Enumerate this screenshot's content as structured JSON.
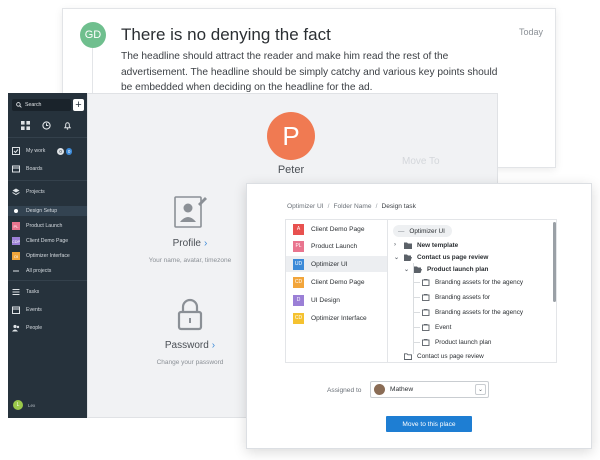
{
  "message": {
    "avatar_initials": "GD",
    "title": "There is no denying the fact",
    "date": "Today",
    "body": "The headline should attract the reader and make him read the rest of the advertisement. The headline should be simply catchy and various key points should be embedded when deciding on the headline for the ad."
  },
  "profile": {
    "avatar_initial": "P",
    "name": "Peter",
    "ghost_text": "Move To",
    "tiles": [
      {
        "title": "Profile",
        "subtitle": "Your name, avatar, timezone"
      },
      {
        "title": "Password",
        "subtitle": "Change your password"
      }
    ]
  },
  "sidebar": {
    "search_label": "Search",
    "add_label": "+",
    "items": [
      {
        "label": "My work",
        "badges": [
          "0",
          "0"
        ]
      },
      {
        "label": "Boards"
      },
      {
        "label": "Projects"
      },
      {
        "label": "Tasks"
      },
      {
        "label": "Events"
      },
      {
        "label": "People"
      }
    ],
    "projects": [
      {
        "label": "Design Setup",
        "initials": "",
        "color": "#3c8ad8",
        "active": true
      },
      {
        "label": "Product Launch",
        "initials": "PL",
        "color": "#e9758f"
      },
      {
        "label": "Client Demo Page",
        "initials": "CDP",
        "color": "#9b7fd6"
      },
      {
        "label": "Optimizer Interface",
        "initials": "OI",
        "color": "#f2a53b"
      }
    ],
    "all_projects_label": "All projects",
    "user": {
      "initials": "L",
      "name": "Lex"
    }
  },
  "dialog": {
    "breadcrumb": [
      "Optimizer UI",
      "Folder Name",
      "Design task"
    ],
    "projects": [
      {
        "label": "Client Demo Page",
        "initials": "A",
        "color": "#e8514f"
      },
      {
        "label": "Product Launch",
        "initials": "PL",
        "color": "#e9758f"
      },
      {
        "label": "Optimizer UI",
        "initials": "UD",
        "color": "#3c8ad8",
        "selected": true
      },
      {
        "label": "Client Demo Page",
        "initials": "CD",
        "color": "#f2a53b"
      },
      {
        "label": "UI Design",
        "initials": "D",
        "color": "#9b7fd6"
      },
      {
        "label": "Optimizer Interface",
        "initials": "CD",
        "color": "#f5c230"
      }
    ],
    "tree_root": "Optimizer UI",
    "tree": [
      {
        "label": "New template",
        "kind": "folder",
        "expanded": false,
        "bold": true
      },
      {
        "label": "Contact us page review",
        "kind": "folder",
        "expanded": true,
        "bold": true
      },
      {
        "label": "Product launch plan",
        "kind": "folder",
        "expanded": true,
        "bold": true
      },
      {
        "label": "Branding assets for the agency",
        "kind": "file"
      },
      {
        "label": "Branding assets for",
        "kind": "file"
      },
      {
        "label": "Branding assets for the agency",
        "kind": "file"
      },
      {
        "label": "Event",
        "kind": "file"
      },
      {
        "label": "Product launch plan",
        "kind": "file"
      },
      {
        "label": "Contact us page review",
        "kind": "folder"
      }
    ],
    "assigned_label": "Assigned to",
    "assignee": "Mathew",
    "move_button": "Move to this place"
  }
}
